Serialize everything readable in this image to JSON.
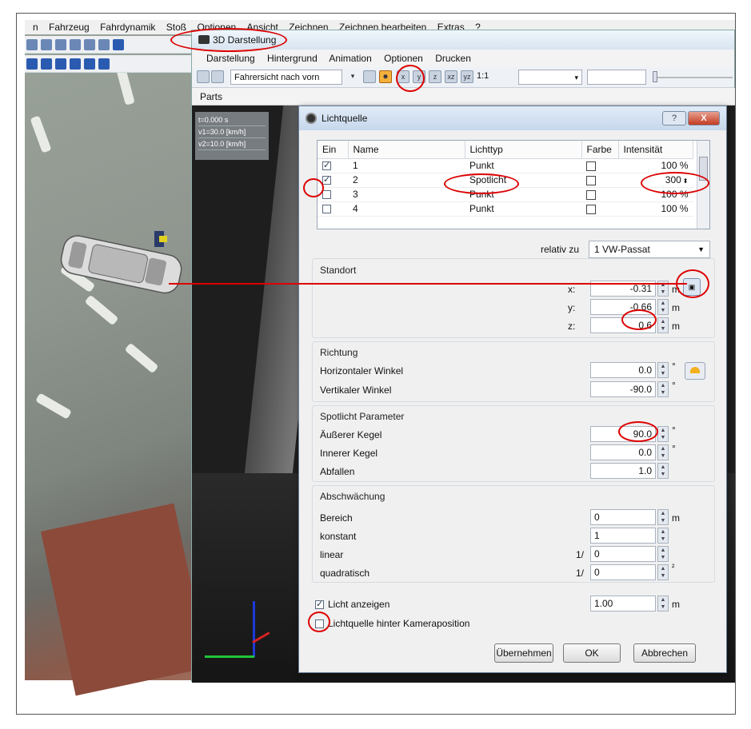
{
  "main_menu": [
    "n",
    "Fahrzeug",
    "Fahrdynamik",
    "Stoß",
    "Optionen",
    "Ansicht",
    "Zeichnen",
    "Zeichnen bearbeiten",
    "Extras",
    "?"
  ],
  "win3d": {
    "title": "3D Darstellung",
    "menu": [
      "Darstellung",
      "Hintergrund",
      "Animation",
      "Optionen",
      "Drucken"
    ],
    "view_select": "Fahrersicht nach vorn",
    "zoom_select": "1:1",
    "parts_label": "Parts"
  },
  "info_panel": {
    "time": "t=0.000 s",
    "v1": "v1=30.0 [km/h]",
    "v2": "v2=10.0 [km/h]"
  },
  "dialog": {
    "title": "Lichtquelle",
    "help_label": "?",
    "close_label": "X",
    "table": {
      "headers": [
        "Ein",
        "Name",
        "Lichttyp",
        "Farbe",
        "Intensität"
      ],
      "rows": [
        {
          "checked": true,
          "name": "1",
          "type": "Punkt",
          "intensity": "100 %"
        },
        {
          "checked": true,
          "name": "2",
          "type": "Spotlicht",
          "intensity": "300"
        },
        {
          "checked": false,
          "name": "3",
          "type": "Punkt",
          "intensity": "100 %"
        },
        {
          "checked": false,
          "name": "4",
          "type": "Punkt",
          "intensity": "100 %"
        }
      ]
    },
    "relative_label": "relativ zu",
    "relative_value": "1 VW-Passat",
    "standort": {
      "title": "Standort",
      "x_label": "x:",
      "x_value": "-0.31",
      "y_label": "y:",
      "y_value": "-0.66",
      "z_label": "z:",
      "z_value": "0.6",
      "unit": "m"
    },
    "richtung": {
      "title": "Richtung",
      "h_label": "Horizontaler Winkel",
      "h_value": "0.0",
      "v_label": "Vertikaler Winkel",
      "v_value": "-90.0",
      "unit": "°"
    },
    "spot": {
      "title": "Spotlicht Parameter",
      "outer_label": "Äußerer Kegel",
      "outer_value": "90.0",
      "inner_label": "Innerer Kegel",
      "inner_value": "0.0",
      "falloff_label": "Abfallen",
      "falloff_value": "1.0",
      "unit": "°"
    },
    "abschwaechung": {
      "title": "Abschwächung",
      "bereich_label": "Bereich",
      "bereich_value": "0",
      "konstant_label": "konstant",
      "konstant_value": "1",
      "linear_label": "linear",
      "linear_value": "0",
      "quad_label": "quadratisch",
      "quad_value": "0",
      "prefix": "1/",
      "unit_m": "m",
      "unit_sq": "²"
    },
    "show_light_label": "Licht anzeigen",
    "show_light_checked": true,
    "show_light_value": "1.00",
    "behind_camera_label": "Lichtquelle hinter Kameraposition",
    "behind_camera_checked": false,
    "buttons": {
      "apply": "Übernehmen",
      "ok": "OK",
      "cancel": "Abbrechen"
    }
  },
  "colors": {
    "highlight": "#dd0000",
    "dialog_bg": "#f0f0f0"
  }
}
